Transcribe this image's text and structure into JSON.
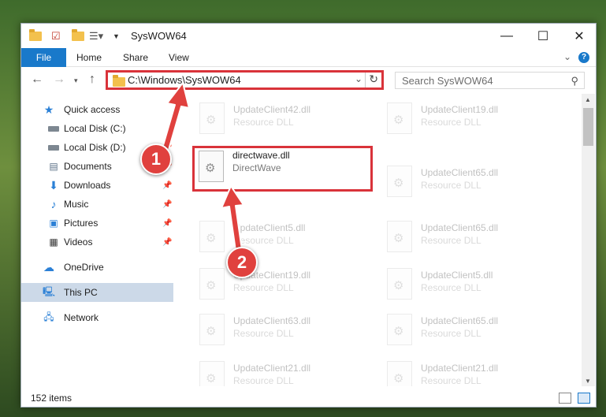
{
  "window": {
    "title": "SysWOW64",
    "minimize": "—",
    "maximize": "☐",
    "close": "✕"
  },
  "ribbon": {
    "tabs": [
      "File",
      "Home",
      "Share",
      "View"
    ],
    "expand": "⌄",
    "help": "?"
  },
  "address": {
    "path": "C:\\Windows\\SysWOW64",
    "search_placeholder": "Search SysWOW64"
  },
  "nav": {
    "items": [
      {
        "label": "Quick access",
        "icon": "star-icon",
        "pinned": false
      },
      {
        "label": "Local Disk (C:)",
        "icon": "drive-icon",
        "pinned": false
      },
      {
        "label": "Local Disk (D:)",
        "icon": "drive-icon",
        "pinned": true
      },
      {
        "label": "Documents",
        "icon": "documents-icon",
        "pinned": true
      },
      {
        "label": "Downloads",
        "icon": "download-icon",
        "pinned": true
      },
      {
        "label": "Music",
        "icon": "music-icon",
        "pinned": true
      },
      {
        "label": "Pictures",
        "icon": "pictures-icon",
        "pinned": true
      },
      {
        "label": "Videos",
        "icon": "videos-icon",
        "pinned": true
      },
      {
        "label": "OneDrive",
        "icon": "cloud-icon",
        "pinned": false
      },
      {
        "label": "This PC",
        "icon": "computer-icon",
        "pinned": false
      },
      {
        "label": "Network",
        "icon": "network-icon",
        "pinned": false
      }
    ]
  },
  "files": [
    {
      "name": "UpdateClient42.dll",
      "desc": "Resource DLL"
    },
    {
      "name": "UpdateClient19.dll",
      "desc": "Resource DLL"
    },
    {
      "name": "directwave.dll",
      "desc": "DirectWave"
    },
    {
      "name": "UpdateClient65.dll",
      "desc": "Resource DLL"
    },
    {
      "name": "UpdateClient5.dll",
      "desc": "Resource DLL"
    },
    {
      "name": "UpdateClient65.dll",
      "desc": "Resource DLL"
    },
    {
      "name": "UpdateClient19.dll",
      "desc": "Resource DLL"
    },
    {
      "name": "UpdateClient5.dll",
      "desc": "Resource DLL"
    },
    {
      "name": "UpdateClient63.dll",
      "desc": "Resource DLL"
    },
    {
      "name": "UpdateClient65.dll",
      "desc": "Resource DLL"
    },
    {
      "name": "UpdateClient21.dll",
      "desc": "Resource DLL"
    },
    {
      "name": "UpdateClient21.dll",
      "desc": "Resource DLL"
    }
  ],
  "status": {
    "items": "152 items"
  },
  "callouts": [
    "1",
    "2"
  ],
  "colors": {
    "accent": "#1979ca",
    "highlight": "#d9333a",
    "callout": "#e0413e",
    "selected": "#ccd9e8"
  }
}
